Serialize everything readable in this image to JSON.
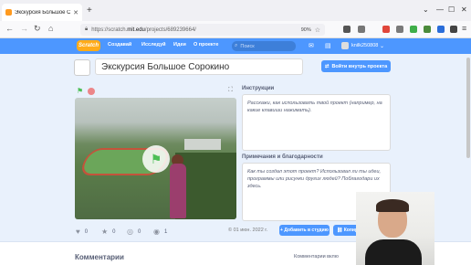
{
  "browser": {
    "tab_title": "Экскурсия Большое Сорокино",
    "new_tab": "+",
    "url_host": "https://scratch.",
    "url_domain": "mit.edu",
    "url_path": "/projects/689239664/",
    "zoom": "90%"
  },
  "scratch_nav": {
    "logo": "Scratch",
    "items": [
      "Создавай",
      "Исследуй",
      "Идеи",
      "О проекте"
    ],
    "search_placeholder": "Поиск",
    "username": "knilk250808"
  },
  "project": {
    "title": "Экскурсия Большое Сорокино",
    "see_inside": "Войти внутрь проекта",
    "instructions_heading": "Инструкции",
    "instructions_placeholder": "Расскажи, как использовать твой проект (например, на какие клавиши нажимать).",
    "notes_heading": "Примечания и благодарности",
    "notes_placeholder": "Как ты создал этот проект? Использовал ли ты идеи, программы или рисунки других людей? Поблагодари их здесь.",
    "loves": "0",
    "favorites": "0",
    "remixes": "0",
    "views": "1",
    "date": "© 01 июн. 2022 г.",
    "add_studio": "+ Добавить в студию",
    "copy_link": "Копир"
  },
  "comments": {
    "heading": "Комментарии",
    "toggle_label": "Комментарии вклю"
  }
}
